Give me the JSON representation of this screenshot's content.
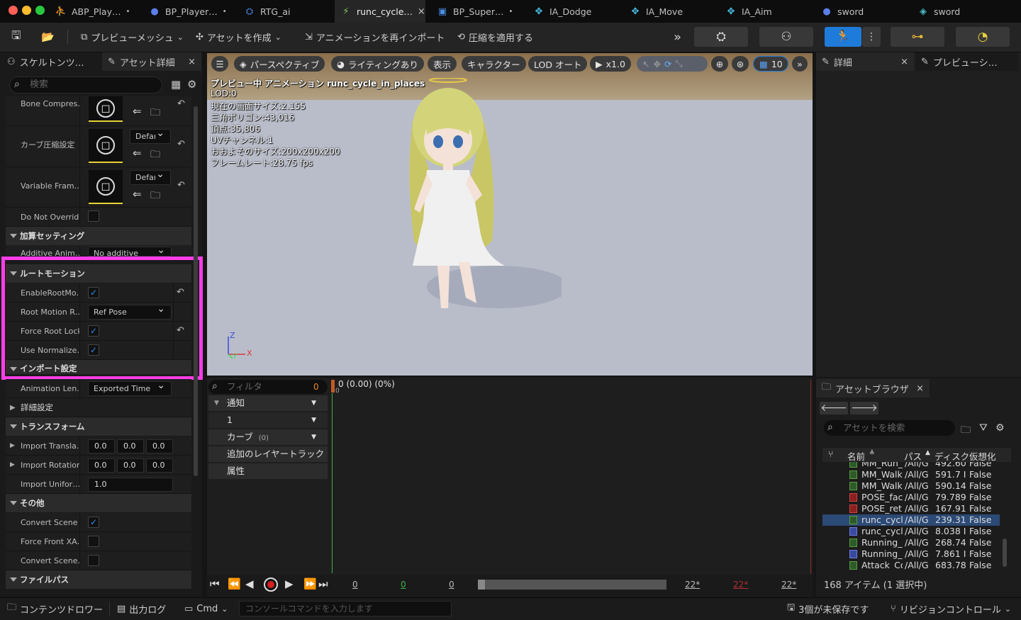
{
  "titlebar": {
    "tabs": [
      {
        "label": "ABP_Play…",
        "dot": "•",
        "icon": "anim-bp-icon"
      },
      {
        "label": "BP_Player…",
        "dot": "•",
        "icon": "actor-bp-icon"
      },
      {
        "label": "RTG_ai",
        "dot": "",
        "icon": "retarget-icon"
      },
      {
        "label": "runc_cycle…",
        "dot": "×",
        "icon": "anim-seq-icon"
      },
      {
        "label": "BP_Super…",
        "dot": "•",
        "icon": "blueprint-icon"
      },
      {
        "label": "IA_Dodge",
        "dot": "",
        "icon": "input-action-icon"
      },
      {
        "label": "IA_Move",
        "dot": "",
        "icon": "input-action-icon"
      },
      {
        "label": "IA_Aim",
        "dot": "",
        "icon": "input-action-icon"
      },
      {
        "label": "sword",
        "dot": "",
        "icon": "skeleton-icon"
      },
      {
        "label": "sword",
        "dot": "",
        "icon": "static-mesh-icon"
      }
    ]
  },
  "toolbar": {
    "preview_mesh": "プレビューメッシュ",
    "create_asset": "アセットを作成",
    "reimport": "アニメーションを再インポート",
    "apply_compression": "圧縮を適用する"
  },
  "left_panel": {
    "tab_skeleton_tree": "スケルトンツ…",
    "tab_asset_details": "アセット詳細",
    "search_placeholder": "検索",
    "rows": {
      "bone_compression": "Bone Compres…",
      "curve_compression": "カーブ圧縮設定",
      "curve_compression_value": "Defaı",
      "variable_frame": "Variable Fram…",
      "variable_frame_value": "Defaı",
      "do_not_override": "Do Not Overrid…",
      "additive_settings": "加算セッティング",
      "additive_anim": "Additive Anim…",
      "additive_anim_value": "No additive",
      "root_motion": "ルートモーション",
      "enable_root_motion": "EnableRootMo…",
      "root_motion_root_lock": "Root Motion R…",
      "root_motion_root_lock_value": "Ref Pose",
      "force_root_lock": "Force Root Lock",
      "use_normalized": "Use Normalize…",
      "import_settings": "インポート設定",
      "animation_length": "Animation Len…",
      "animation_length_value": "Exported Time",
      "advanced": "詳細設定",
      "transform": "トランスフォーム",
      "import_translation": "Import Transla…",
      "import_rotation": "Import Rotation",
      "import_uniform": "Import Unifor…",
      "misc": "その他",
      "convert_scene": "Convert Scene",
      "force_front_xa": "Force Front XA…",
      "convert_scene_unit": "Convert Scene…",
      "file_path": "ファイルパス"
    },
    "translation_values": [
      "0.0",
      "0.0",
      "0.0"
    ],
    "rotation_values": [
      "0.0",
      "0.0",
      "0.0"
    ],
    "uniform_scale": "1.0"
  },
  "viewport": {
    "perspective": "パースペクティブ",
    "lighting": "ライティングあり",
    "show": "表示",
    "character": "キャラクター",
    "lod": "LOD オート",
    "play_speed": "x1.0",
    "grid_size": "10",
    "stats": [
      "プレビュー中 アニメーション runc_cycle_in_places",
      "LOD:0",
      "現在の画面サイズ:2.155",
      "三角ポリゴン:43,016",
      "頂点:35,806",
      "UVチャンネル:1",
      "おおよそのサイズ:200x200x200",
      "フレームレート:28.75 fps"
    ],
    "axis_z": "Z",
    "axis_x": "X",
    "axis_y": "Y"
  },
  "right_panel": {
    "tab_details": "詳細",
    "tab_preview": "プレビューシ…"
  },
  "timeline": {
    "filter_placeholder": "フィルタ",
    "filter_count": "0",
    "position": "0 (0.00) (0%)",
    "position_marker": "0",
    "tracks": {
      "notify": "通知",
      "notify_track": "1",
      "curves": "カーブ",
      "curves_count": "(0)",
      "additive_layer": "追加のレイヤートラック",
      "attributes": "属性"
    },
    "bottom": {
      "start": "0",
      "green": "0",
      "mid": "0",
      "end_a": "22*",
      "end_b": "22*",
      "end_c": "22*"
    }
  },
  "asset_browser": {
    "tab_label": "アセットブラウザ",
    "search_placeholder": "アセットを検索",
    "columns": [
      "名前",
      "パス",
      "ディスク",
      "仮想化"
    ],
    "rows": [
      {
        "name": "MM_Run_",
        "path": "/All/G",
        "size": "492.60",
        "virt": "False",
        "type": "anim"
      },
      {
        "name": "MM_Walk",
        "path": "/All/G",
        "size": "591.7 I",
        "virt": "False",
        "type": "anim"
      },
      {
        "name": "MM_Walk",
        "path": "/All/G",
        "size": "590.14",
        "virt": "False",
        "type": "anim"
      },
      {
        "name": "POSE_fac",
        "path": "/All/G",
        "size": "79.789",
        "virt": "False",
        "type": "pose"
      },
      {
        "name": "POSE_ret",
        "path": "/All/G",
        "size": "167.91",
        "virt": "False",
        "type": "pose"
      },
      {
        "name": "runc_cycl",
        "path": "/All/G",
        "size": "239.31",
        "virt": "False",
        "type": "anim"
      },
      {
        "name": "runc_cycl",
        "path": "/All/G",
        "size": "8.038 I",
        "virt": "False",
        "type": "anim2"
      },
      {
        "name": "Running_",
        "path": "/All/G",
        "size": "268.74",
        "virt": "False",
        "type": "anim"
      },
      {
        "name": "Running_",
        "path": "/All/G",
        "size": "7.861 I",
        "virt": "False",
        "type": "anim2"
      },
      {
        "name": "Attack_Co",
        "path": "/All/G",
        "size": "683.78",
        "virt": "False",
        "type": "anim"
      }
    ],
    "selected_index": 5,
    "footer": "168 アイテム (1 選択中)"
  },
  "statusbar": {
    "content_drawer": "コンテンツドロワー",
    "output_log": "出力ログ",
    "cmd": "Cmd",
    "console_placeholder": "コンソールコマンドを入力します",
    "unsaved": "3個が未保存です",
    "revision_control": "リビジョンコントロール"
  },
  "colors": {
    "highlight": "#ff3ee8",
    "accent_blue": "#1f7bd9",
    "selected_row": "#2c4a76"
  }
}
